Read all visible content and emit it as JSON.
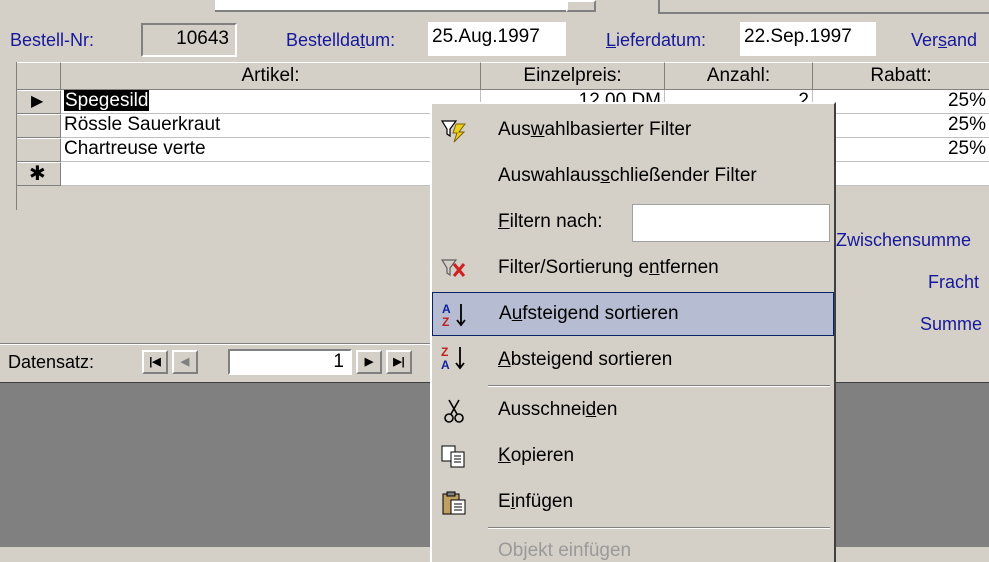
{
  "form": {
    "order_no_label": "Bestell-Nr:",
    "order_no": "10643",
    "order_date_label": "Bestelldatum:",
    "order_date": "25.Aug.1997",
    "delivery_label": "Lieferdatum:",
    "delivery_date": "22.Sep.1997",
    "ship_label": "Versand"
  },
  "grid": {
    "headers": [
      "Artikel:",
      "Einzelpreis:",
      "Anzahl:",
      "Rabatt:"
    ],
    "rows": [
      {
        "artikel": "Spegesild",
        "preis": "12,00 DM",
        "anzahl": "2",
        "rabatt": "25%"
      },
      {
        "artikel": "Rössle Sauerkraut",
        "preis": "",
        "anzahl": "",
        "rabatt": "25%"
      },
      {
        "artikel": "Chartreuse verte",
        "preis": "",
        "anzahl": "",
        "rabatt": "25%"
      }
    ],
    "new_row_marker": "✱",
    "current_marker": "▶"
  },
  "totals": {
    "subtotal_label": "Zwischensumme",
    "freight_label": "Fracht",
    "sum_label": "Summe"
  },
  "nav": {
    "label": "Datensatz:",
    "record": "1"
  },
  "menu": {
    "items": [
      {
        "label": "Auswahlbasierter Filter",
        "icon": "filter-by-selection-icon"
      },
      {
        "label": "Auswahlausschließender Filter",
        "icon": ""
      },
      {
        "label": "Filtern nach:",
        "icon": ""
      },
      {
        "label": "Filter/Sortierung entfernen",
        "icon": "remove-filter-icon"
      },
      {
        "label": "Aufsteigend sortieren",
        "icon": "sort-ascending-icon"
      },
      {
        "label": "Absteigend sortieren",
        "icon": "sort-descending-icon"
      },
      {
        "label": "Ausschneiden",
        "icon": "cut-icon"
      },
      {
        "label": "Kopieren",
        "icon": "copy-icon"
      },
      {
        "label": "Einfügen",
        "icon": "paste-icon"
      },
      {
        "label": "Objekt einfügen",
        "icon": ""
      }
    ],
    "filter_input_value": ""
  }
}
